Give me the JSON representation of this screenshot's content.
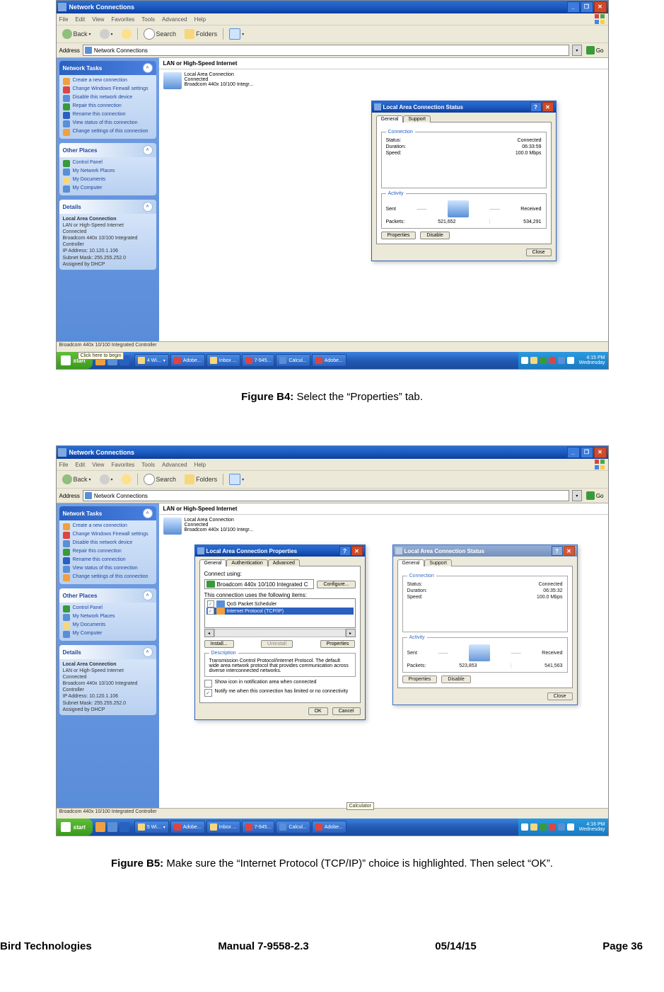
{
  "captions": {
    "b4_bold": "Figure B4:",
    "b4_text": " Select the “Properties” tab.",
    "b5_bold": "Figure B5:",
    "b5_text": " Make sure the “Internet Protocol (TCP/IP)” choice is highlighted. Then select “OK”."
  },
  "footer": {
    "left": "Bird Technologies",
    "center": "Manual 7-9558-2.3",
    "date": "05/14/15",
    "page": "Page 36"
  },
  "window": {
    "title": "Network Connections",
    "menu": [
      "File",
      "Edit",
      "View",
      "Favorites",
      "Tools",
      "Advanced",
      "Help"
    ],
    "toolbar": {
      "back": "Back",
      "search": "Search",
      "folders": "Folders"
    },
    "address_label": "Address",
    "address_value": "Network Connections",
    "go": "Go",
    "section": "LAN or High-Speed Internet",
    "conn_name": "Local Area Connection",
    "conn_state": "Connected",
    "conn_device": "Broadcom 440x 10/100 Integr...",
    "status_b4": "Broadcom 440x 10/100 Integrated Controller",
    "status_b5": "Broadcom 440x 10/100 Integrated Controller",
    "tooltip": "Click here to begin",
    "calc_tip": "Calculator"
  },
  "sidebar": {
    "tasks_title": "Network Tasks",
    "tasks": [
      "Create a new connection",
      "Change Windows Firewall settings",
      "Disable this network device",
      "Repair this connection",
      "Rename this connection",
      "View status of this connection",
      "Change settings of this connection"
    ],
    "places_title": "Other Places",
    "places": [
      "Control Panel",
      "My Network Places",
      "My Documents",
      "My Computer"
    ],
    "details_title": "Details",
    "details": {
      "name": "Local Area Connection",
      "type": "LAN or High-Speed Internet",
      "state": "Connected",
      "device": "Broadcom 440x 10/100 Integrated Controller",
      "ip": "IP Address: 10.120.1.106",
      "mask": "Subnet Mask: 255.255.252.0",
      "assigned": "Assigned by DHCP"
    }
  },
  "status_dialog": {
    "title": "Local Area Connection Status",
    "tabs": [
      "General",
      "Support"
    ],
    "conn_legend": "Connection",
    "status_lbl": "Status:",
    "duration_lbl": "Duration:",
    "speed_lbl": "Speed:",
    "status_val": "Connected",
    "speed_val": "100.0 Mbps",
    "activity_legend": "Activity",
    "sent": "Sent",
    "received": "Received",
    "packets": "Packets:",
    "properties": "Properties",
    "disable": "Disable",
    "close": "Close",
    "b4": {
      "duration": "06:33:59",
      "sent": "521,652",
      "recv": "534,291"
    },
    "b5": {
      "duration": "06:35:32",
      "sent": "523,853",
      "recv": "541,563"
    }
  },
  "props_dialog": {
    "title": "Local Area Connection Properties",
    "tabs": [
      "General",
      "Authentication",
      "Advanced"
    ],
    "connect_using": "Connect using:",
    "nic": "Broadcom 440x 10/100 Integrated C",
    "configure": "Configure...",
    "items_label": "This connection uses the following items:",
    "item_sched": "QoS Packet Scheduler",
    "item_tcpip": "Internet Protocol (TCP/IP)",
    "install": "Install...",
    "uninstall": "Uninstall",
    "properties": "Properties",
    "desc_legend": "Description",
    "desc_text": "Transmission Control Protocol/Internet Protocol. The default wide area network protocol that provides communication across diverse interconnected networks.",
    "show_icon": "Show icon in notification area when connected",
    "notify": "Notify me when this connection has limited or no connectivity",
    "ok": "OK",
    "cancel": "Cancel"
  },
  "taskbar": {
    "start": "start",
    "tasks": [
      "4 Wi...",
      "Adobe...",
      "Inbox ...",
      "7-945...",
      "Calcul...",
      "Adobe..."
    ],
    "tasks_b5": [
      "5 Wi...",
      "Adobe...",
      "Inbox ...",
      "7-945...",
      "Calcul...",
      "Adobe..."
    ],
    "time_b4": "4:15 PM",
    "time_b5": "4:16 PM",
    "day": "Wednesday"
  }
}
